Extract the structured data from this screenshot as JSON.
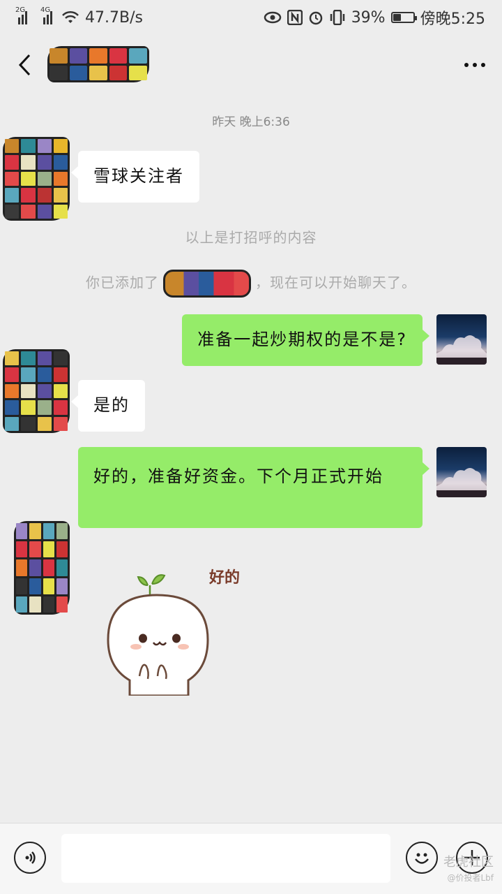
{
  "status_bar": {
    "network_left": "2G",
    "network_right": "4G",
    "speed": "47.7B/s",
    "battery": "39%",
    "battery_level": 0.39,
    "time": "傍晚5:25",
    "icons": [
      "signal-icon",
      "wifi-icon",
      "eye-icon",
      "nfc-icon",
      "alarm-icon",
      "vibrate-icon",
      "battery-icon"
    ]
  },
  "nav": {
    "title": "",
    "back_icon": "chevron-left-icon",
    "more_icon": "more-dots-icon"
  },
  "chat": {
    "timestamp": "昨天 晚上6:36",
    "system_greeting": "以上是打招呼的内容",
    "system_added_prefix": "你已添加了",
    "system_added_suffix": "，现在可以开始聊天了。",
    "messages": [
      {
        "side": "left",
        "text": "雪球关注者"
      },
      {
        "side": "right",
        "text": "准备一起炒期权的是不是?"
      },
      {
        "side": "left",
        "text": "是的"
      },
      {
        "side": "right",
        "text": "好的，准备好资金。下个月正式开始"
      }
    ],
    "sticker_text": "好的"
  },
  "input_bar": {
    "placeholder": "",
    "voice_icon": "voice-icon",
    "emoji_icon": "emoji-icon",
    "plus_icon": "plus-icon"
  },
  "watermark": {
    "line1": "老虎社区",
    "line2": "@价投者Lbf"
  }
}
